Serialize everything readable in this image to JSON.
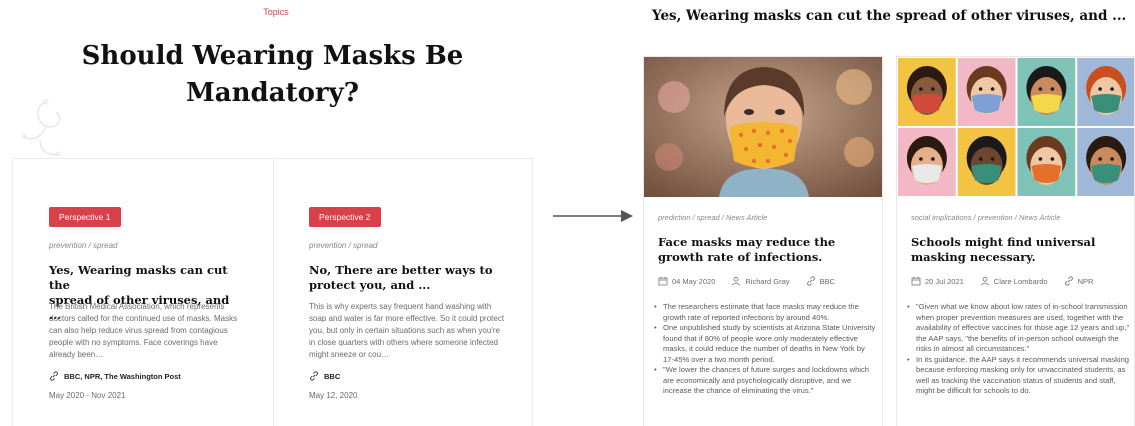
{
  "left": {
    "topics_label": "Topics",
    "title_line1": "Should Wearing Masks Be",
    "title_line2": "Mandatory?",
    "perspectives": [
      {
        "badge": "Perspective 1",
        "tags": "prevention / spread",
        "title_line1": "Yes, Wearing masks can cut the",
        "title_line2": "spread of other viruses, and ...",
        "body": "The British Medical Association, which represents doctors called for the continued use of masks. Masks can also help reduce virus spread from contagious people with no symptoms. Face coverings have already been…",
        "sources": "BBC, NPR, The Washington Post",
        "date_range": "May 2020 - Nov 2021"
      },
      {
        "badge": "Perspective 2",
        "tags": "prevention / spread",
        "title_line1": "No, There are better ways to",
        "title_line2": "protect you, and ...",
        "body": "This is why experts say frequent hand washing with soap and water is far more effective. So it could protect you, but only in certain situations such as when you're in close quarters with others where someone infected might sneeze or cou…",
        "sources": "BBC",
        "date_range": "May 12, 2020"
      }
    ]
  },
  "right": {
    "title": "Yes, Wearing masks can cut the spread of other viruses, and ...",
    "articles": [
      {
        "meta": "prediction / spread / News Article",
        "title_line1": "Face masks may reduce the",
        "title_line2": "growth rate of infections.",
        "date": "04 May 2020",
        "author": "Richard Gray",
        "source": "BBC",
        "bullets": [
          "The researchers estimate that face masks may reduce the growth rate of reported infections by around 40%.",
          "One unpublished study by scientists at Arizona State University found that if 80% of people wore only moderately effective masks, it could reduce the number of deaths in New York by 17-45% over a two month period.",
          "\"We lower the chances of future surges and lockdowns which are economically and psychologically disruptive, and we increase the chance of eliminating the virus.\""
        ]
      },
      {
        "meta": "social implications / prevention / News Article",
        "title_line1": "Schools might find universal",
        "title_line2": "masking necessary.",
        "date": "20 Jul 2021",
        "author": "Clare Lombardo",
        "source": "NPR",
        "bullets": [
          "\"Given what we know about low rates of in-school transmission when proper prevention measures are used, together with the availability of effective vaccines for those age 12 years and up,\" the AAP says, \"the benefits of in-person school outweigh the risks in almost all circumstances.\"",
          "In its guidance, the AAP says it recommends universal masking because enforcing masking only for unvaccinated students, as well as tracking the vaccination status of students and staff, might be difficult for schools to do."
        ]
      }
    ]
  },
  "colors": {
    "accent": "#d8414a",
    "text_dark": "#111111",
    "text_muted": "#6b6b6b",
    "arrow": "#555555"
  }
}
